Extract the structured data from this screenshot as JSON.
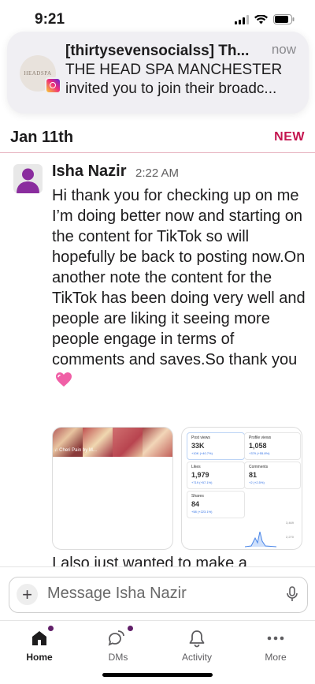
{
  "status_bar": {
    "time": "9:21"
  },
  "notification": {
    "avatar_text": "HEADSPA",
    "title": "[thirtysevensocialss] Th...",
    "time": "now",
    "line1": "THE HEAD SPA MANCHESTER",
    "line2": "invited you to join their broadc..."
  },
  "day_divider": {
    "label": "Jan 11th",
    "badge": "NEW"
  },
  "message": {
    "sender": "Isha Nazir",
    "time": "2:22 AM",
    "body": "Hi thank you for checking up on me I’m doing better now and starting on the content for TikTok so will hopefully be back to posting now.On another note the content for the TikTok has been doing very well and people are liking it seeing more people engage in terms of comments and saves.So thank you",
    "emoji": "pink-heart"
  },
  "attachment_1": {
    "caption": "Cheri Pain by M..."
  },
  "attachment_2": {
    "stats": [
      {
        "label": "Post views",
        "value": "33K",
        "change": "+10K (+40.7%)"
      },
      {
        "label": "Profile views",
        "value": "1,058",
        "change": "+379 (+55.8%)"
      },
      {
        "label": "Likes",
        "value": "1,979",
        "change": "+719 (+57.1%)"
      },
      {
        "label": "Comments",
        "value": "81",
        "change": "+2 (+2.5%)"
      },
      {
        "label": "Shares",
        "value": "84",
        "change": "+58 (+223.1%)"
      }
    ],
    "axis_top": "3,469",
    "axis_mid": "2,270"
  },
  "next_message_fragment": "I also just wanted to make a",
  "composer": {
    "placeholder": "Message Isha Nazir"
  },
  "tabs": [
    {
      "label": "Home"
    },
    {
      "label": "DMs"
    },
    {
      "label": "Activity"
    },
    {
      "label": "More"
    }
  ],
  "colors": {
    "accent": "#c4154f",
    "avatar": "#8a2d9e",
    "badge": "#611f69"
  }
}
